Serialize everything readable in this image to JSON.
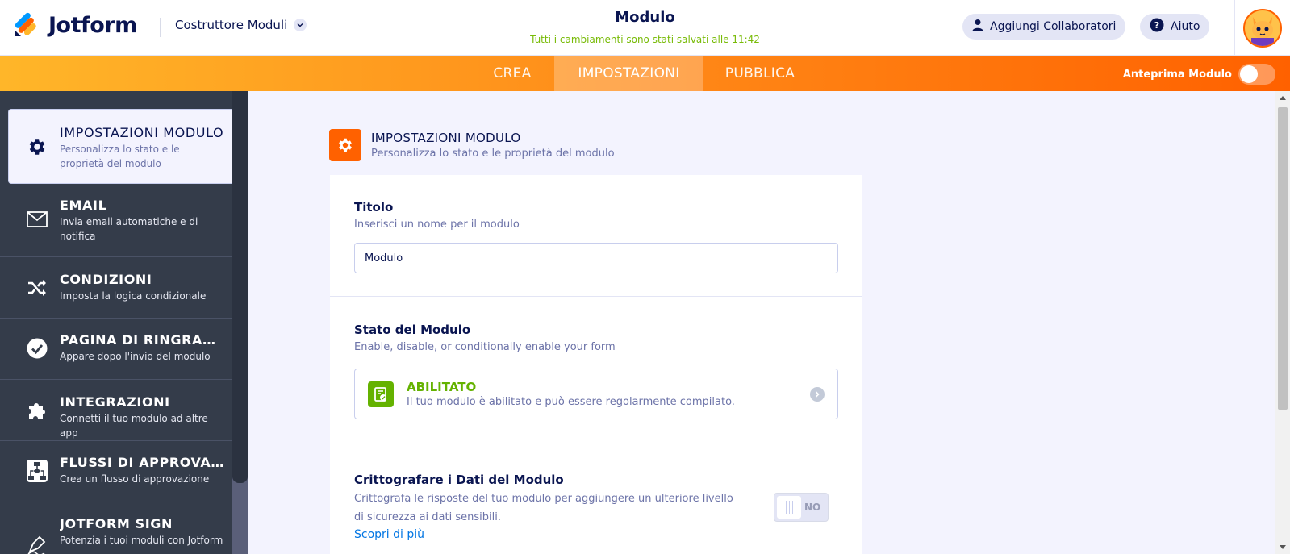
{
  "header": {
    "logo_text": "Jotform",
    "builder_label": "Costruttore Moduli",
    "form_title": "Modulo",
    "saved_status": "Tutti i cambiamenti sono stati salvati alle 11:42",
    "collaborators_label": "Aggiungi Collaboratori",
    "help_label": "Aiuto"
  },
  "navbar": {
    "tabs": [
      {
        "label": "CREA"
      },
      {
        "label": "IMPOSTAZIONI"
      },
      {
        "label": "PUBBLICA"
      }
    ],
    "active_tab": "IMPOSTAZIONI",
    "preview_label": "Anteprima Modulo",
    "preview_on": false
  },
  "sidebar": {
    "items": [
      {
        "title": "IMPOSTAZIONI MODULO",
        "desc": "Personalizza lo stato e le proprietà del modulo",
        "icon": "gear-icon"
      },
      {
        "title": "EMAIL",
        "desc": "Invia email automatiche e di notifica",
        "icon": "envelope-icon"
      },
      {
        "title": "CONDIZIONI",
        "desc": "Imposta la logica condizionale",
        "icon": "shuffle-icon"
      },
      {
        "title": "PAGINA DI RINGRAZIAMENTO",
        "desc": "Appare dopo l'invio del modulo",
        "icon": "check-circle-icon"
      },
      {
        "title": "INTEGRAZIONI",
        "desc": "Connetti il tuo modulo ad altre app",
        "icon": "puzzle-icon"
      },
      {
        "title": "FLUSSI DI APPROVAZIONE",
        "desc": "Crea un flusso di approvazione",
        "icon": "workflow-icon"
      },
      {
        "title": "JOTFORM SIGN",
        "desc": "Potenzia i tuoi moduli con Jotform",
        "icon": "pen-icon"
      }
    ]
  },
  "main": {
    "section_title": "IMPOSTAZIONI MODULO",
    "section_subtitle": "Personalizza lo stato e le proprietà del modulo",
    "title_block": {
      "label": "Titolo",
      "help": "Inserisci un nome per il modulo",
      "value": "Modulo"
    },
    "status_block": {
      "label": "Stato del Modulo",
      "help": "Enable, disable, or conditionally enable your form",
      "status_title": "ABILITATO",
      "status_desc": "Il tuo modulo è abilitato e può essere regolarmente compilato."
    },
    "encrypt_block": {
      "label": "Crittografare i Dati del Modulo",
      "help": "Crittografa le risposte del tuo modulo per aggiungere un ulteriore livello di sicurezza ai dati sensibili.",
      "learn_more": "Scopri di più",
      "toggle_label": "NO"
    }
  },
  "colors": {
    "accent": "#ff6100",
    "enabled_green": "#64b200",
    "saved_green": "#78bb07",
    "link_blue": "#0075e3",
    "sidebar_bg": "#343c4a"
  }
}
